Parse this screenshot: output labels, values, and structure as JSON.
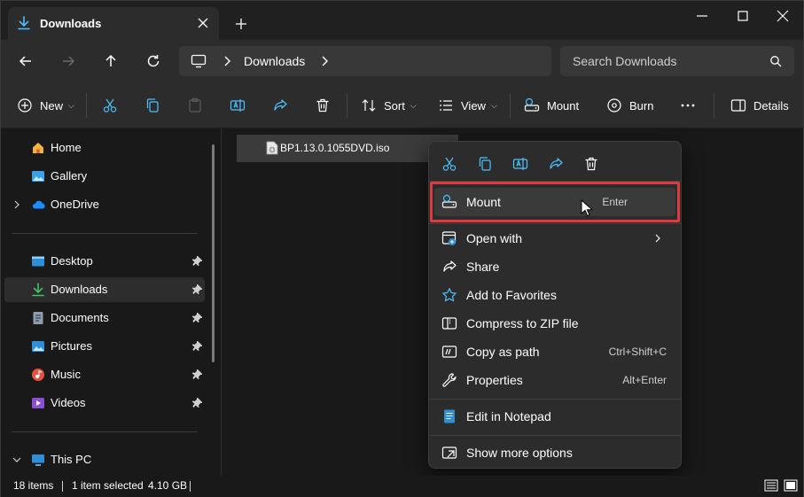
{
  "window": {
    "tab_title": "Downloads"
  },
  "address": {
    "breadcrumb": "Downloads",
    "search_placeholder": "Search Downloads"
  },
  "commands": {
    "new": "New",
    "sort": "Sort",
    "view": "View",
    "mount": "Mount",
    "burn": "Burn",
    "details": "Details"
  },
  "sidebar": {
    "items": [
      {
        "label": "Home"
      },
      {
        "label": "Gallery"
      },
      {
        "label": "OneDrive"
      },
      {
        "label": "Desktop"
      },
      {
        "label": "Downloads"
      },
      {
        "label": "Documents"
      },
      {
        "label": "Pictures"
      },
      {
        "label": "Music"
      },
      {
        "label": "Videos"
      },
      {
        "label": "This PC"
      }
    ]
  },
  "content": {
    "file_name": "BP1.13.0.1055DVD.iso"
  },
  "context_menu": {
    "items": [
      {
        "label": "Mount",
        "accel": "Enter"
      },
      {
        "label": "Open with",
        "accel": ""
      },
      {
        "label": "Share",
        "accel": ""
      },
      {
        "label": "Add to Favorites",
        "accel": ""
      },
      {
        "label": "Compress to ZIP file",
        "accel": ""
      },
      {
        "label": "Copy as path",
        "accel": "Ctrl+Shift+C"
      },
      {
        "label": "Properties",
        "accel": "Alt+Enter"
      },
      {
        "label": "Edit in Notepad",
        "accel": ""
      },
      {
        "label": "Show more options",
        "accel": ""
      }
    ]
  },
  "status": {
    "items_count": "18 items",
    "selection": "1 item selected",
    "size": "4.10 GB"
  },
  "colors": {
    "accent": "#4cc2ff",
    "highlight_border": "#e0393e",
    "background": "#191919",
    "toolbar": "#2c2c2c"
  },
  "icons": [
    "download-icon",
    "close-icon",
    "plus-icon",
    "minimize-icon",
    "maximize-icon",
    "back-icon",
    "forward-icon",
    "up-icon",
    "refresh-icon",
    "computer-icon",
    "chevron-right-icon",
    "search-icon",
    "new-icon",
    "cut-icon",
    "copy-icon",
    "paste-icon",
    "rename-icon",
    "share-icon",
    "delete-icon",
    "sort-icon",
    "view-icon",
    "mount-icon",
    "burn-icon",
    "more-icon",
    "details-icon",
    "home-icon",
    "gallery-icon",
    "cloud-icon",
    "desktop-icon",
    "documents-icon",
    "pictures-icon",
    "music-icon",
    "videos-icon",
    "pin-icon",
    "iso-file-icon",
    "open-with-icon",
    "star-icon",
    "zip-icon",
    "copy-path-icon",
    "wrench-icon",
    "notepad-icon",
    "show-more-icon",
    "cursor-icon"
  ]
}
